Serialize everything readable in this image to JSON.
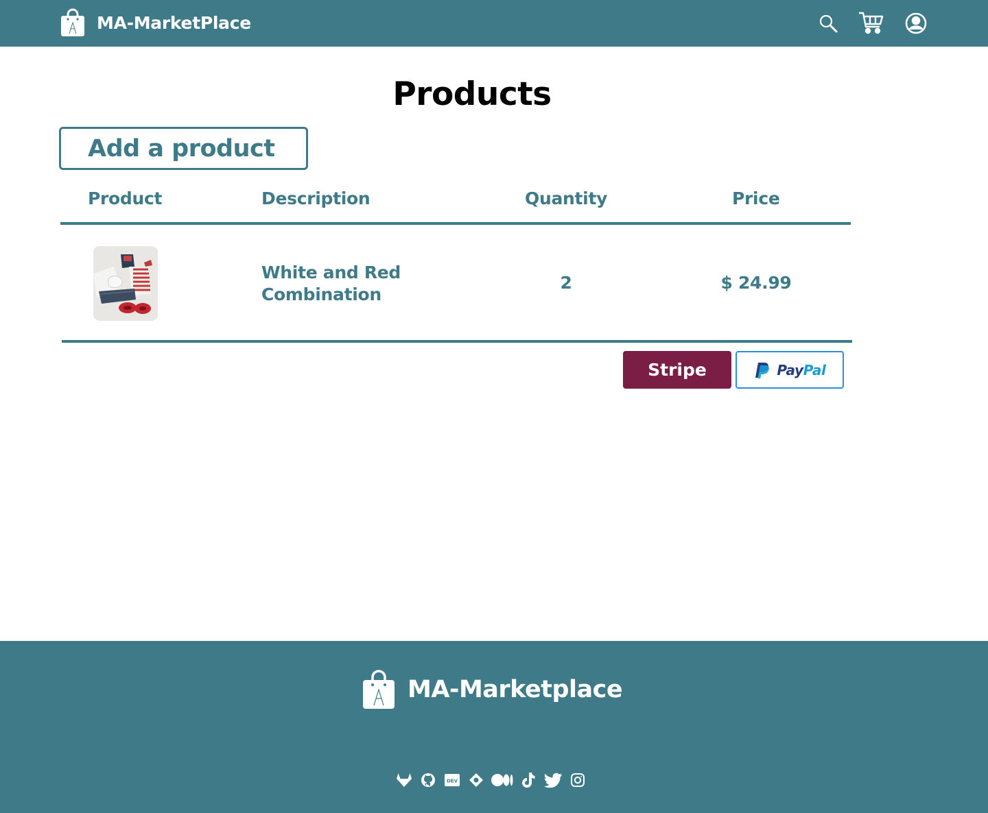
{
  "header": {
    "brand_name": "MA-MarketPlace",
    "icons": [
      "search-icon",
      "cart-icon",
      "account-icon"
    ]
  },
  "page": {
    "title": "Products",
    "add_button_label": "Add a product"
  },
  "table": {
    "columns": [
      "Product",
      "Description",
      "Quantity",
      "Price"
    ],
    "rows": [
      {
        "image": "product-photo",
        "description": "White and Red Combination",
        "quantity": "2",
        "price": "$ 24.99"
      }
    ]
  },
  "payment": {
    "stripe_label": "Stripe",
    "paypal_label_part1": "Pay",
    "paypal_label_part2": "Pal"
  },
  "footer": {
    "brand_name": "MA-Marketplace",
    "social_icons": [
      "gitlab-icon",
      "github-icon",
      "dev-icon",
      "hashnode-icon",
      "medium-icon",
      "tiktok-icon",
      "twitter-icon",
      "instagram-icon"
    ]
  },
  "colors": {
    "primary": "#3f7a89",
    "stripe": "#7b1e45",
    "paypal_border": "#2c90d8",
    "paypal_dark": "#253b80",
    "paypal_light": "#179bd7"
  }
}
